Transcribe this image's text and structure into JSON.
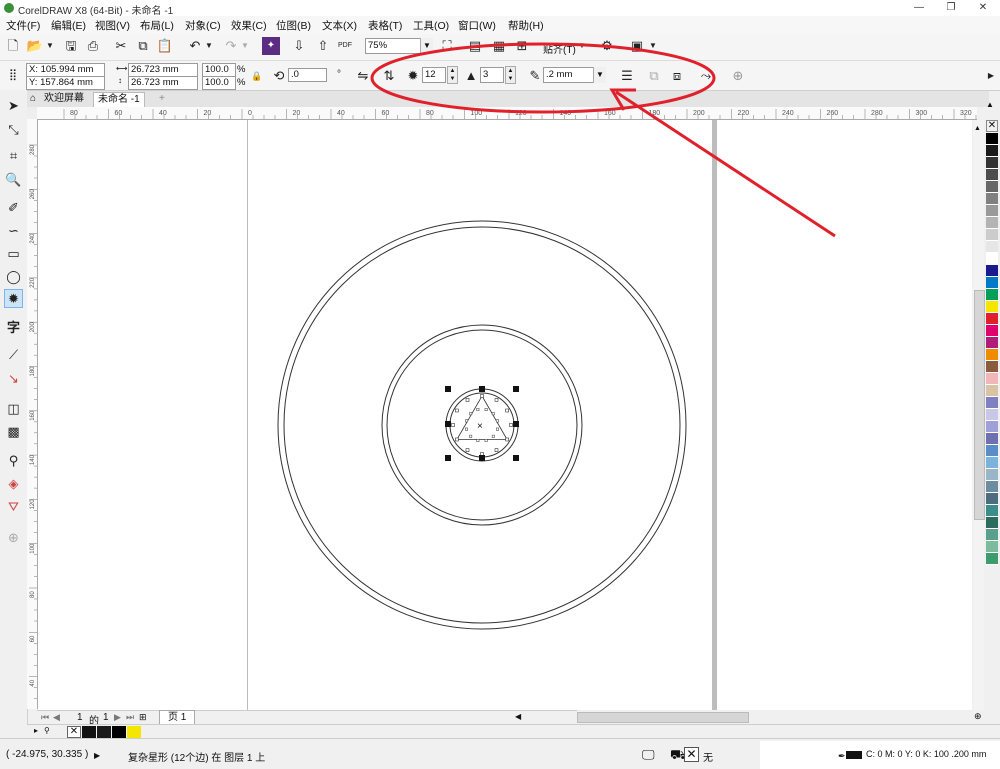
{
  "window": {
    "title": "CorelDRAW X8 (64-Bit) - 未命名 -1",
    "minimize": "—",
    "restore": "❐",
    "close": "✕"
  },
  "menu": [
    "文件(F)",
    "编辑(E)",
    "视图(V)",
    "布局(L)",
    "对象(C)",
    "效果(C)",
    "位图(B)",
    "文本(X)",
    "表格(T)",
    "工具(O)",
    "窗口(W)",
    "帮助(H)"
  ],
  "standard": {
    "zoom": "75%",
    "snap_label": "贴齐(T)",
    "pdf_label": "PDF"
  },
  "property": {
    "x": "X: 105.994 mm",
    "y": "Y: 157.864 mm",
    "w": "26.723 mm",
    "h": "26.723 mm",
    "sx": "100.0",
    "sy": "100.0",
    "pct1": "%",
    "pct2": "%",
    "rotate": ".0",
    "points": "12",
    "sharpness": "3",
    "outline": ".2 mm"
  },
  "tabs": {
    "welcome": "欢迎屏幕",
    "doc": "未命名 -1",
    "add": "+"
  },
  "hruler": [
    "80",
    "60",
    "40",
    "20",
    "0",
    "20",
    "40",
    "60",
    "80",
    "100",
    "120",
    "140",
    "160",
    "180",
    "200",
    "220",
    "240",
    "260",
    "280",
    "300",
    "320"
  ],
  "vruler": [
    "280",
    "260",
    "240",
    "220",
    "200",
    "180",
    "160",
    "140",
    "120",
    "100",
    "80",
    "60",
    "40",
    "20"
  ],
  "pagenav": {
    "current": "1",
    "of": "的",
    "total": "1",
    "page_tab": "页 1"
  },
  "status": {
    "coords": "( -24.975, 30.335 )",
    "message": "复杂星形 (12个边) 在 图层 1 上",
    "fill_none": "无",
    "outline_info": "C: 0 M: 0 Y: 0 K: 100  .200 mm"
  },
  "colors": {
    "accent": "#e0202a",
    "palette": [
      "#000000",
      "#1a1a1a",
      "#333333",
      "#4d4d4d",
      "#666666",
      "#808080",
      "#999999",
      "#b3b3b3",
      "#cccccc",
      "#e6e6e6",
      "#ffffff",
      "#1b1b8f",
      "#0078c8",
      "#00a05a",
      "#f5e600",
      "#e0202a",
      "#e0006e",
      "#b01c7a",
      "#f08c00",
      "#8c5a3c",
      "#f2b6b6",
      "#d8c3a5",
      "#8080c0",
      "#c8c8e6",
      "#a0a0d8",
      "#7070b0",
      "#5a8cc8",
      "#7ab4dc",
      "#9ab4c8",
      "#6c8ca0",
      "#4c6c80",
      "#3c8c8c",
      "#2c6c5c",
      "#5aa08c",
      "#7cbc9c",
      "#3c9c6c"
    ]
  }
}
